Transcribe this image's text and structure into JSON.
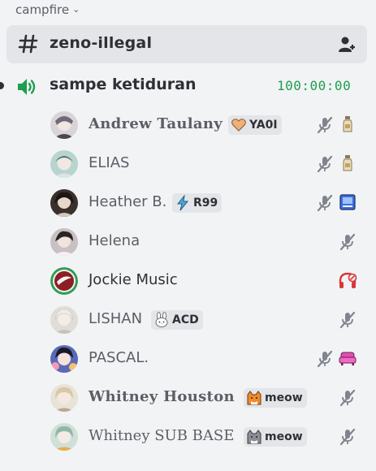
{
  "category": {
    "label": "campfire"
  },
  "text_channel": {
    "name": "zeno-illegal"
  },
  "voice_channel": {
    "name": "sampe ketiduran",
    "timer": "100:00:00"
  },
  "members": [
    {
      "name": "Andrew Taulany",
      "tag": "YA0I",
      "tag_icon": "heart-icon",
      "deafened_icon": "mic-off-icon",
      "activity_icon": "bottle-icon"
    },
    {
      "name": "ELIAS",
      "deafened_icon": "mic-off-icon",
      "activity_icon": "bottle-icon"
    },
    {
      "name": "Heather B.",
      "tag": "R99",
      "tag_icon": "lightning-icon",
      "deafened_icon": "mic-off-icon",
      "activity_icon": "book-icon"
    },
    {
      "name": "Helena",
      "deafened_icon": "mic-off-icon"
    },
    {
      "name": "Jockie Music",
      "activity_icon": "headphones-off-icon"
    },
    {
      "name": "LISHAN",
      "tag": "ACD",
      "tag_icon": "rabbit-icon",
      "deafened_icon": "mic-off-icon"
    },
    {
      "name": "PASCAL.",
      "deafened_icon": "mic-off-icon",
      "activity_icon": "sofa-icon"
    },
    {
      "name": "Whitney Houston",
      "tag": "meow",
      "tag_icon": "cat-icon",
      "deafened_icon": "mic-off-icon"
    },
    {
      "name": "Whitney SUB BASE",
      "tag": "meow",
      "tag_icon": "cat-icon",
      "deafened_icon": "mic-off-icon"
    }
  ],
  "colors": {
    "background": "#f2f3f5",
    "selected_channel": "#e3e5e8",
    "voice_green": "#1e9e4e",
    "muted_gray": "#5c5e66",
    "deafened_red": "#da373c"
  }
}
